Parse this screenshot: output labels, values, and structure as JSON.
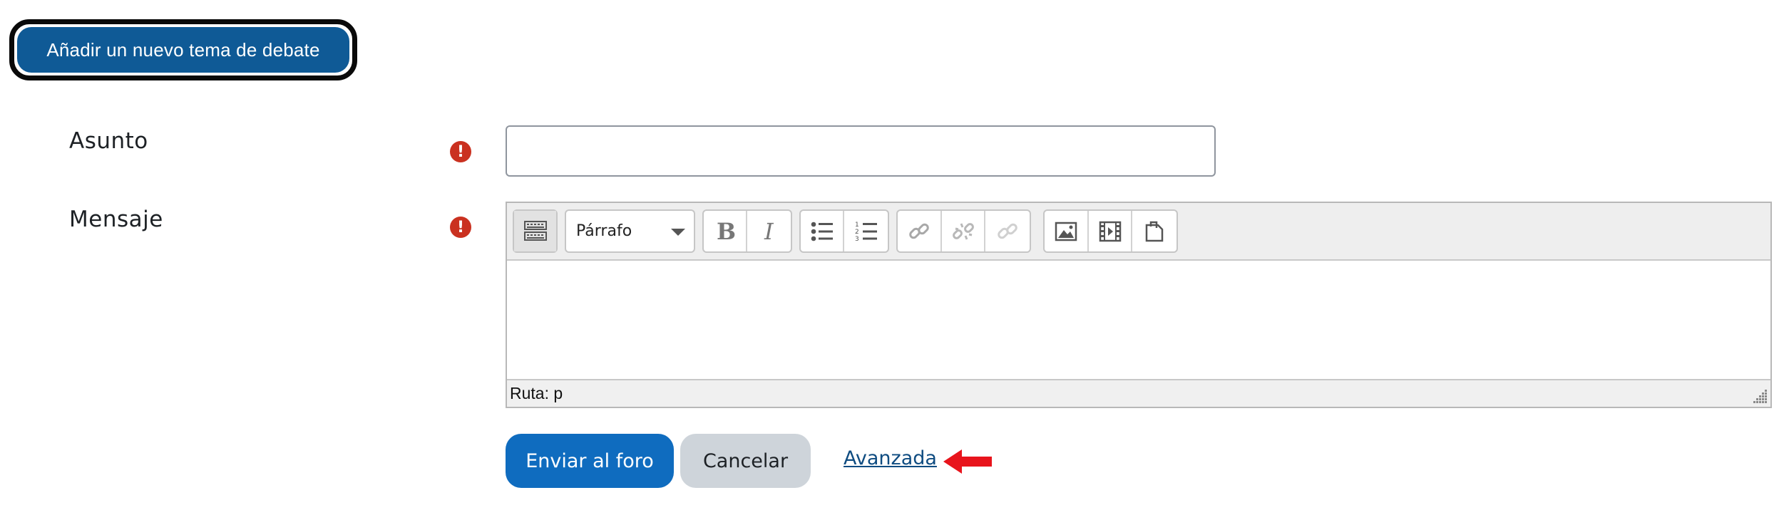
{
  "header": {
    "new_topic_label": "Añadir un nuevo tema de debate"
  },
  "form": {
    "subject_label": "Asunto",
    "message_label": "Mensaje",
    "required_mark": "!",
    "subject_value": "",
    "editor": {
      "format_selected": "Párrafo",
      "path_status": "Ruta: p",
      "content": ""
    }
  },
  "actions": {
    "submit_label": "Enviar al foro",
    "cancel_label": "Cancelar",
    "advanced_label": "Avanzada"
  },
  "colors": {
    "primary": "#0f6cbf",
    "new_topic": "#0f5a96",
    "secondary": "#ced4da",
    "required": "#ca3120",
    "arrow": "#e8141c",
    "link": "#0f4c81"
  },
  "icons": {
    "toolbar": [
      "toolbar-toggle-icon",
      "bold-icon",
      "italic-icon",
      "unordered-list-icon",
      "ordered-list-icon",
      "link-icon",
      "unlink-icon",
      "emoji-link-icon",
      "image-icon",
      "media-icon",
      "manage-files-icon"
    ]
  }
}
